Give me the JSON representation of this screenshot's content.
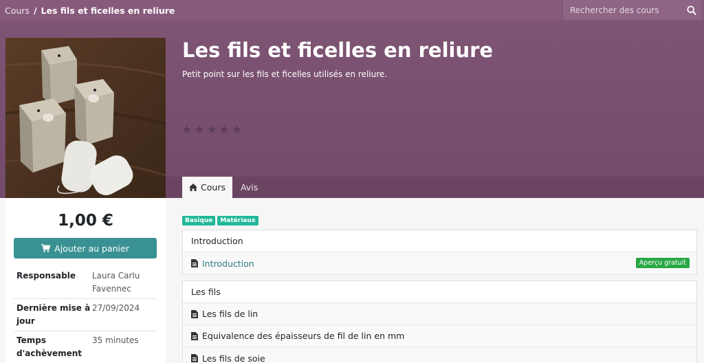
{
  "breadcrumb": {
    "root": "Cours",
    "separator": "/",
    "current": "Les fils et ficelles en reliure"
  },
  "search": {
    "placeholder": "Rechercher des cours"
  },
  "course": {
    "title": "Les fils et ficelles en reliure",
    "subtitle": "Petit point sur les fils et ficelles utilisés en reliure.",
    "rating_stars": 5,
    "rating_filled": 0
  },
  "tabs": [
    {
      "label": "Cours",
      "active": true,
      "icon": "home-icon"
    },
    {
      "label": "Avis",
      "active": false
    }
  ],
  "sidebar": {
    "price": "1,00 €",
    "cart_label": "Ajouter au panier",
    "info": [
      {
        "label": "Responsable",
        "value": "Laura Carlu Favennec"
      },
      {
        "label": "Dernière mise à jour",
        "value": "27/09/2024"
      },
      {
        "label": "Temps d'achèvement",
        "value": "35 minutes"
      }
    ]
  },
  "tags": [
    "Basique",
    "Matériaux"
  ],
  "sections": [
    {
      "title": "Introduction",
      "items": [
        {
          "label": "Introduction",
          "link": true,
          "badge": "Aperçu gratuit"
        }
      ]
    },
    {
      "title": "Les fils",
      "items": [
        {
          "label": "Les fils de lin",
          "link": false
        },
        {
          "label": "Equivalence des épaisseurs de fil de lin en mm",
          "link": false
        },
        {
          "label": "Les fils de soie",
          "link": false
        }
      ]
    }
  ],
  "colors": {
    "brand": "#875a7b",
    "hero": "#7e5574",
    "cart_button": "#3a9193",
    "tag": "#21b799",
    "free_badge": "#28a745",
    "link": "#2f7a7c"
  }
}
